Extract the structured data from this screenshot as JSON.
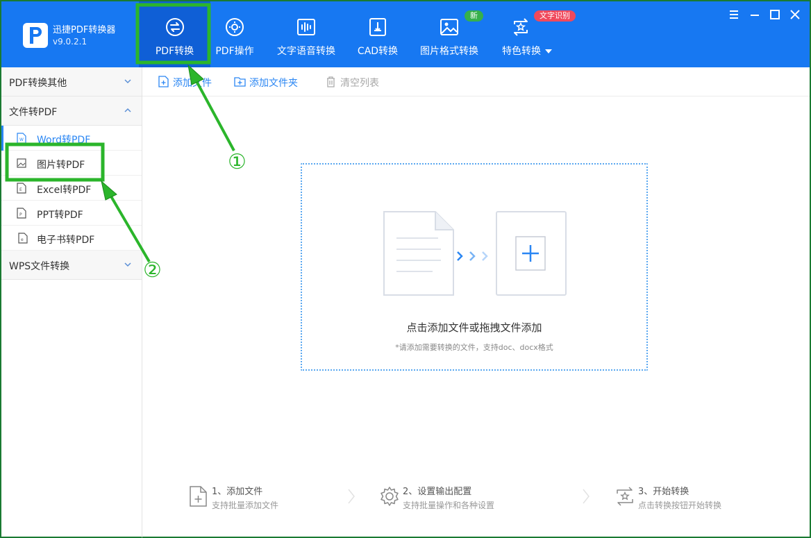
{
  "app": {
    "name": "迅捷PDF转换器",
    "version": "v9.0.2.1"
  },
  "nav": {
    "tabs": [
      {
        "label": "PDF转换",
        "icon": "convert-icon",
        "active": true
      },
      {
        "label": "PDF操作",
        "icon": "pdf-operate-icon"
      },
      {
        "label": "文字语音转换",
        "icon": "audio-wave-icon"
      },
      {
        "label": "CAD转换",
        "icon": "cad-icon"
      },
      {
        "label": "图片格式转换",
        "icon": "image-icon"
      },
      {
        "label": "特色转换",
        "icon": "special-convert-icon"
      }
    ],
    "badges": {
      "new": "新",
      "ocr": "文字识别"
    }
  },
  "sidebar": {
    "groups": [
      {
        "label": "PDF转换其他",
        "expanded": false
      },
      {
        "label": "文件转PDF",
        "expanded": true
      },
      {
        "label": "WPS文件转换",
        "expanded": false
      }
    ],
    "items": [
      {
        "label": "Word转PDF",
        "icon": "word-file-icon",
        "active": true
      },
      {
        "label": "图片转PDF",
        "icon": "image-file-icon"
      },
      {
        "label": "Excel转PDF",
        "icon": "excel-file-icon"
      },
      {
        "label": "PPT转PDF",
        "icon": "ppt-file-icon"
      },
      {
        "label": "电子书转PDF",
        "icon": "ebook-file-icon"
      }
    ]
  },
  "toolbar": {
    "add_file": "添加文件",
    "add_folder": "添加文件夹",
    "clear_list": "清空列表"
  },
  "dropzone": {
    "title": "点击添加文件或拖拽文件添加",
    "subtitle": "*请添加需要转换的文件，支持doc、docx格式"
  },
  "steps": [
    {
      "title": "1、添加文件",
      "subtitle": "支持批量添加文件",
      "icon": "add-file-icon"
    },
    {
      "title": "2、设置输出配置",
      "subtitle": "支持批量操作和各种设置",
      "icon": "settings-gear-icon"
    },
    {
      "title": "3、开始转换",
      "subtitle": "点击转换按钮开始转换",
      "icon": "start-convert-icon"
    }
  ],
  "annotations": {
    "marker1": "①",
    "marker2": "②"
  },
  "colors": {
    "header": "#1778f2",
    "accent": "#2a86f3",
    "highlight": "#2bb52b"
  }
}
